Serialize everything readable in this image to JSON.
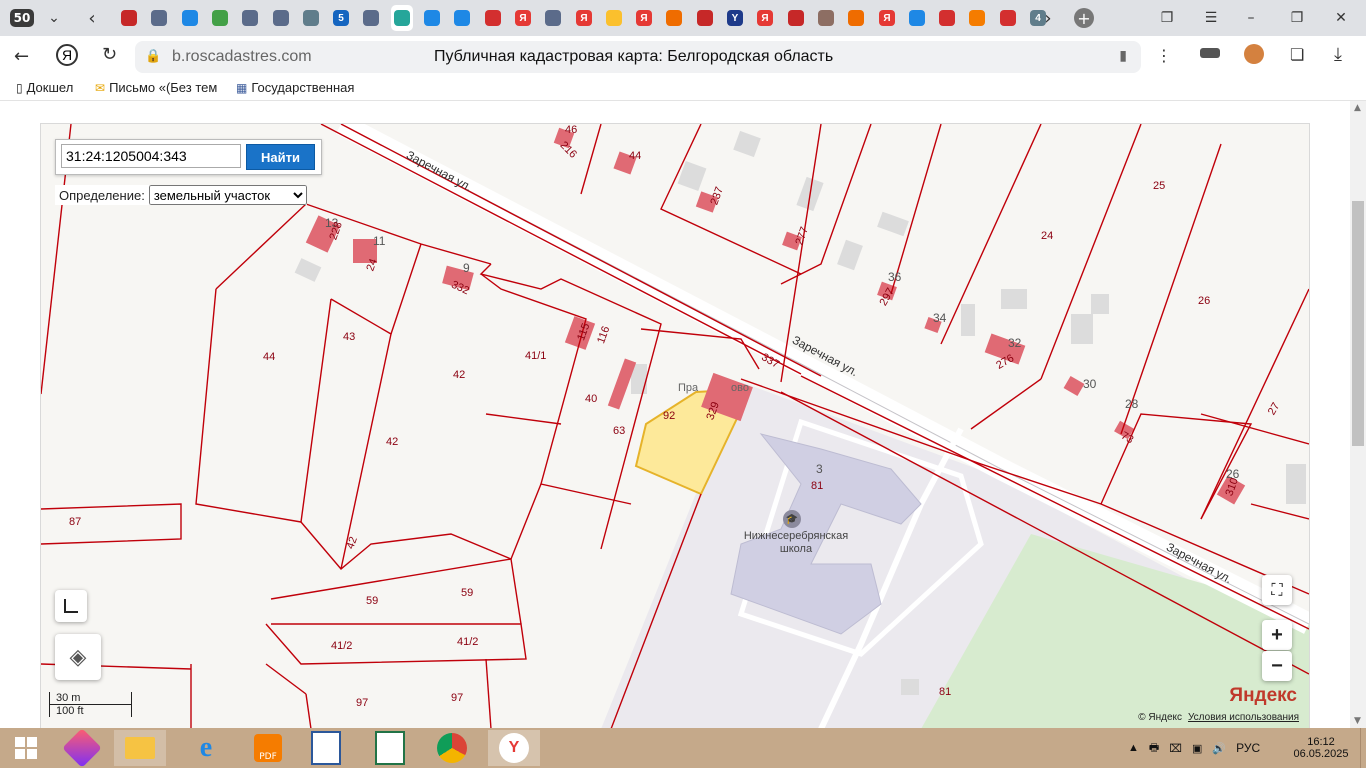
{
  "browser": {
    "tab_count": "50",
    "page_title": "Публичная кадастровая карта: Белгородская область",
    "url": "b.roscadastres.com",
    "tabs": [
      {
        "icon": "gear-red",
        "color": "#c62828",
        "label": ""
      },
      {
        "icon": "gerb",
        "color": "#5b6b8a",
        "label": ""
      },
      {
        "icon": "gosuslugi",
        "color": "#1e88e5",
        "label": ""
      },
      {
        "icon": "gerb-green",
        "color": "#43a047",
        "label": ""
      },
      {
        "icon": "gerb",
        "color": "#5b6b8a",
        "label": ""
      },
      {
        "icon": "gerb",
        "color": "#5b6b8a",
        "label": ""
      },
      {
        "icon": "document",
        "color": "#607d8b",
        "label": ""
      },
      {
        "icon": "channel5",
        "color": "#1565c0",
        "label": "5"
      },
      {
        "icon": "gerb",
        "color": "#5b6b8a",
        "label": ""
      },
      {
        "icon": "cadastre",
        "color": "#26a69a",
        "label": ""
      },
      {
        "icon": "gosuslugi",
        "color": "#1e88e5",
        "label": ""
      },
      {
        "icon": "gosuslugi",
        "color": "#1e88e5",
        "label": ""
      },
      {
        "icon": "ru-flag",
        "color": "#d32f2f",
        "label": ""
      },
      {
        "icon": "yandex",
        "color": "#e53935",
        "label": "Я"
      },
      {
        "icon": "gerb",
        "color": "#5b6b8a",
        "label": ""
      },
      {
        "icon": "yandex",
        "color": "#e53935",
        "label": "Я"
      },
      {
        "icon": "flag-color",
        "color": "#fbc02d",
        "label": ""
      },
      {
        "icon": "yandex",
        "color": "#e53935",
        "label": "Я"
      },
      {
        "icon": "search-orange",
        "color": "#ef6c00",
        "label": ""
      },
      {
        "icon": "bird",
        "color": "#c62828",
        "label": ""
      },
      {
        "icon": "y-blue",
        "color": "#1e3a8a",
        "label": "Y"
      },
      {
        "icon": "yandex",
        "color": "#e53935",
        "label": "Я"
      },
      {
        "icon": "bird",
        "color": "#c62828",
        "label": ""
      },
      {
        "icon": "avatar",
        "color": "#8d6e63",
        "label": ""
      },
      {
        "icon": "search-orange",
        "color": "#ef6c00",
        "label": ""
      },
      {
        "icon": "yandex",
        "color": "#e53935",
        "label": "Я"
      },
      {
        "icon": "gosuslugi",
        "color": "#1e88e5",
        "label": ""
      },
      {
        "icon": "ru-flag",
        "color": "#d32f2f",
        "label": ""
      },
      {
        "icon": "ok",
        "color": "#f57c00",
        "label": ""
      },
      {
        "icon": "ru-flag",
        "color": "#d32f2f",
        "label": ""
      },
      {
        "icon": "number",
        "color": "#607d8b",
        "label": "4"
      }
    ],
    "bookmarks": [
      {
        "label": "Докшел",
        "icon": "document-icon"
      },
      {
        "label": "Письмо «(Без тем",
        "icon": "mail-icon"
      },
      {
        "label": "Государственная",
        "icon": "building-icon"
      }
    ]
  },
  "search": {
    "value": "31:24:1205004:343",
    "button_label": "Найти",
    "definition_label": "Определение:",
    "definition_value": "земельный участок"
  },
  "map": {
    "street_labels": [
      "Заречная ул.",
      "Заречная ул.",
      "Заречная ул."
    ],
    "school_label_line1": "Нижнесеребрянская",
    "school_label_line2": "школа",
    "poi_partial": "Пра",
    "poi_partial_end": "ово",
    "parcels": [
      "44",
      "43",
      "42",
      "42",
      "41/1",
      "40",
      "87",
      "59",
      "59",
      "41/2",
      "41/2",
      "97",
      "97",
      "24",
      "25",
      "26",
      "27",
      "92",
      "63",
      "81",
      "81",
      "44",
      "13",
      "11",
      "9",
      "36",
      "34",
      "32",
      "30",
      "28",
      "26",
      "3",
      "46",
      "216",
      "228",
      "24",
      "332",
      "115",
      "116",
      "329",
      "237",
      "277",
      "297",
      "276",
      "73",
      "310",
      "337",
      "42"
    ],
    "scale_metric": "30 m",
    "scale_imperial": "100 ft",
    "attribution": "© Яндекс",
    "terms_link": "Условия использования",
    "logo": "Яндекс",
    "zoom_in": "+",
    "zoom_out": "−"
  },
  "taskbar": {
    "language": "РУС",
    "time": "16:12",
    "date": "06.05.2025"
  },
  "colors": {
    "parcel_border": "#c0000a",
    "selected_parcel": "#fde99a",
    "building": "#e06a74",
    "school": "#d0cfe3",
    "park": "#d7ebcf",
    "search_button": "#1a73c8"
  }
}
